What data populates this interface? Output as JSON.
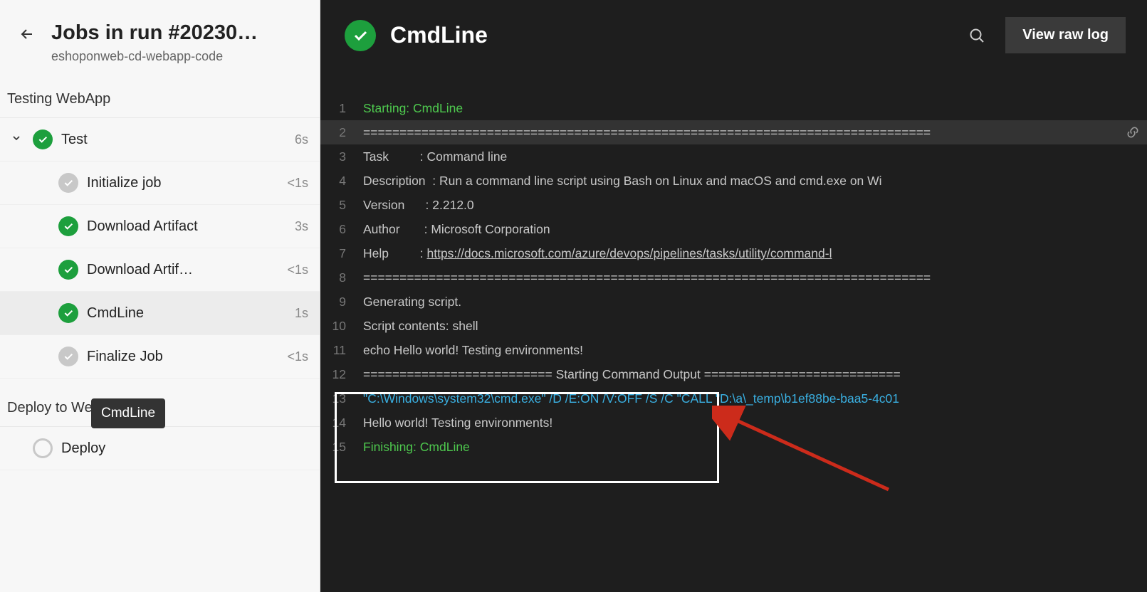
{
  "sidebar": {
    "title": "Jobs in run #20230…",
    "subtitle": "eshoponweb-cd-webapp-code",
    "tooltip": "CmdLine",
    "stages": [
      {
        "name": "Testing WebApp",
        "jobs": [
          {
            "name": "Test",
            "duration": "6s",
            "status": "green",
            "expanded": true,
            "steps": [
              {
                "name": "Initialize job",
                "duration": "<1s",
                "status": "gray"
              },
              {
                "name": "Download Artifact",
                "duration": "3s",
                "status": "green"
              },
              {
                "name": "Download Artif…",
                "duration": "<1s",
                "status": "green"
              },
              {
                "name": "CmdLine",
                "duration": "1s",
                "status": "green",
                "selected": true
              },
              {
                "name": "Finalize Job",
                "duration": "<1s",
                "status": "gray"
              }
            ]
          }
        ]
      },
      {
        "name": "Deploy to WebApp",
        "jobs": [
          {
            "name": "Deploy",
            "duration": "",
            "status": "empty",
            "expanded": false,
            "steps": []
          }
        ]
      }
    ]
  },
  "header": {
    "title": "CmdLine",
    "raw_log": "View raw log"
  },
  "log_lines": [
    {
      "n": 1,
      "seg": [
        {
          "t": "Starting: CmdLine",
          "c": "green"
        }
      ]
    },
    {
      "n": 2,
      "selected": true,
      "permalink": true,
      "seg": [
        {
          "t": "==============================================================================",
          "c": ""
        }
      ]
    },
    {
      "n": 3,
      "seg": [
        {
          "t": "Task         : Command line",
          "c": ""
        }
      ]
    },
    {
      "n": 4,
      "seg": [
        {
          "t": "Description  : Run a command line script using Bash on Linux and macOS and cmd.exe on Wi",
          "c": ""
        }
      ]
    },
    {
      "n": 5,
      "seg": [
        {
          "t": "Version      : 2.212.0",
          "c": ""
        }
      ]
    },
    {
      "n": 6,
      "seg": [
        {
          "t": "Author       : Microsoft Corporation",
          "c": ""
        }
      ]
    },
    {
      "n": 7,
      "seg": [
        {
          "t": "Help         : ",
          "c": ""
        },
        {
          "t": "https://docs.microsoft.com/azure/devops/pipelines/tasks/utility/command-l",
          "c": "link"
        }
      ]
    },
    {
      "n": 8,
      "seg": [
        {
          "t": "==============================================================================",
          "c": ""
        }
      ]
    },
    {
      "n": 9,
      "seg": [
        {
          "t": "Generating script.",
          "c": ""
        }
      ]
    },
    {
      "n": 10,
      "seg": [
        {
          "t": "Script contents: shell",
          "c": ""
        }
      ]
    },
    {
      "n": 11,
      "seg": [
        {
          "t": "echo Hello world! Testing environments!",
          "c": ""
        }
      ]
    },
    {
      "n": 12,
      "seg": [
        {
          "t": "========================== Starting Command Output ===========================",
          "c": ""
        }
      ]
    },
    {
      "n": 13,
      "seg": [
        {
          "t": "\"C:\\Windows\\system32\\cmd.exe\" /D /E:ON /V:OFF /S /C \"CALL \"D:\\a\\_temp\\b1ef88be-baa5-4c01",
          "c": "cyan"
        }
      ]
    },
    {
      "n": 14,
      "seg": [
        {
          "t": "Hello world! Testing environments!",
          "c": ""
        }
      ]
    },
    {
      "n": 15,
      "seg": [
        {
          "t": "Finishing: CmdLine",
          "c": "green"
        }
      ]
    }
  ]
}
